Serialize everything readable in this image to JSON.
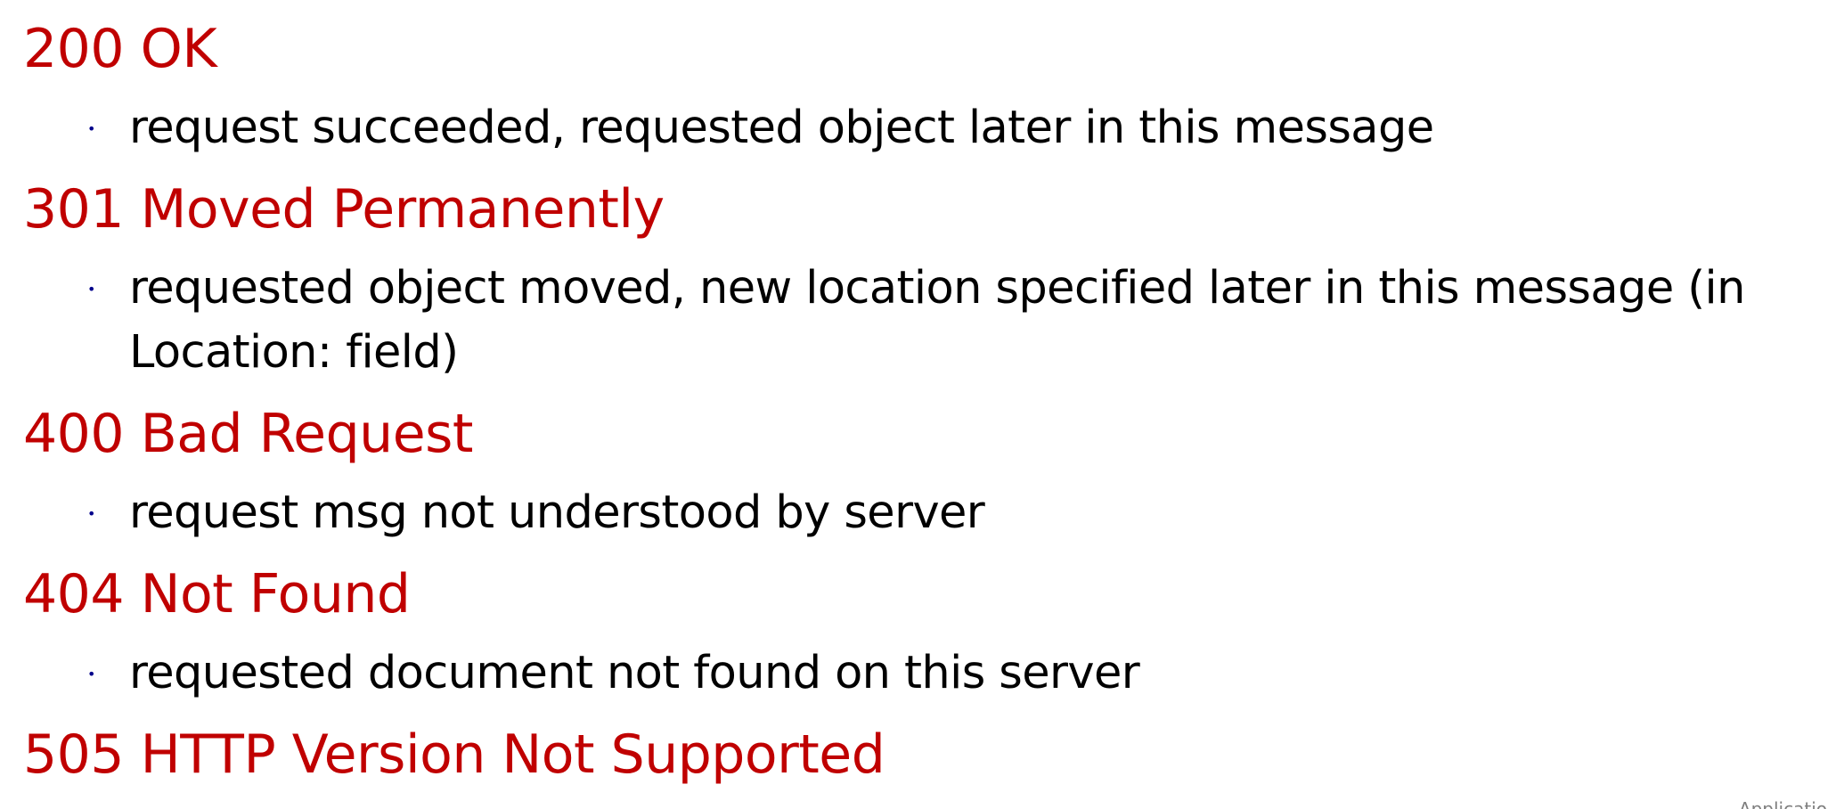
{
  "theme": {
    "heading_color": "#c00000",
    "text_color": "#000000",
    "bullet_color": "#00008b",
    "corner_color": "#7f7f7f"
  },
  "bullet_glyph": "•",
  "items": [
    {
      "code": "200 OK",
      "details": [
        "request succeeded, requested object later in this message"
      ]
    },
    {
      "code": "301 Moved Permanently",
      "details": [
        "requested object moved, new location specified later in this message (in",
        "Location: field)"
      ]
    },
    {
      "code": "400 Bad Request",
      "details": [
        "request msg not understood by server"
      ]
    },
    {
      "code": "404 Not Found",
      "details": [
        "requested document not found on this server"
      ]
    },
    {
      "code": "505 HTTP Version Not Supported",
      "details": []
    }
  ],
  "footer": {
    "corner_text": "Applicatio"
  }
}
